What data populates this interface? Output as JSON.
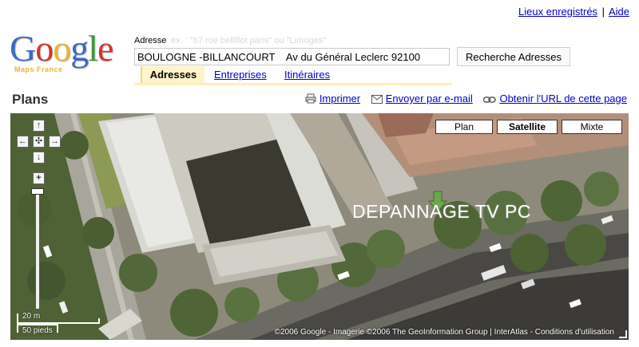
{
  "top_links": {
    "saved": "Lieux enregistrés",
    "separator": "|",
    "help": "Aide"
  },
  "logo": {
    "word": [
      "G",
      "o",
      "o",
      "g",
      "l",
      "e"
    ],
    "sub": "Maps France"
  },
  "search": {
    "label": "Adresse",
    "hint": "ex. : \"67 rue bellillot paris\" ou \"Limoges\"",
    "value": "BOULOGNE -BILLANCOURT    Av du Général Leclerc 92100",
    "button": "Recherche Adresses"
  },
  "tabs": {
    "addresses": "Adresses",
    "businesses": "Entreprises",
    "directions": "Itinéraires"
  },
  "section": {
    "title": "Plans"
  },
  "actions": {
    "print": "Imprimer",
    "email": "Envoyer par e-mail",
    "link": "Obtenir l'URL de cette page"
  },
  "map": {
    "types": {
      "plan": "Plan",
      "satellite": "Satellite",
      "mixed": "Mixte"
    },
    "selected_type": "Satellite",
    "overlay_label": "DEPANNAGE TV  PC",
    "scale": {
      "metric": "20 m",
      "imperial": "50 pieds"
    },
    "copyright": "©2006 Google - Imagerie ©2006 The GeoInformation Group | InterAtlas - Conditions d'utilisation",
    "nav": {
      "up": "↑",
      "down": "↓",
      "left": "←",
      "right": "→",
      "center": "✣",
      "zoom_in": "+",
      "zoom_out": "−"
    }
  },
  "colors": {
    "link": "#0000cc",
    "tab_active_bg": "#fff4cc",
    "map_base": "#9a9585"
  }
}
